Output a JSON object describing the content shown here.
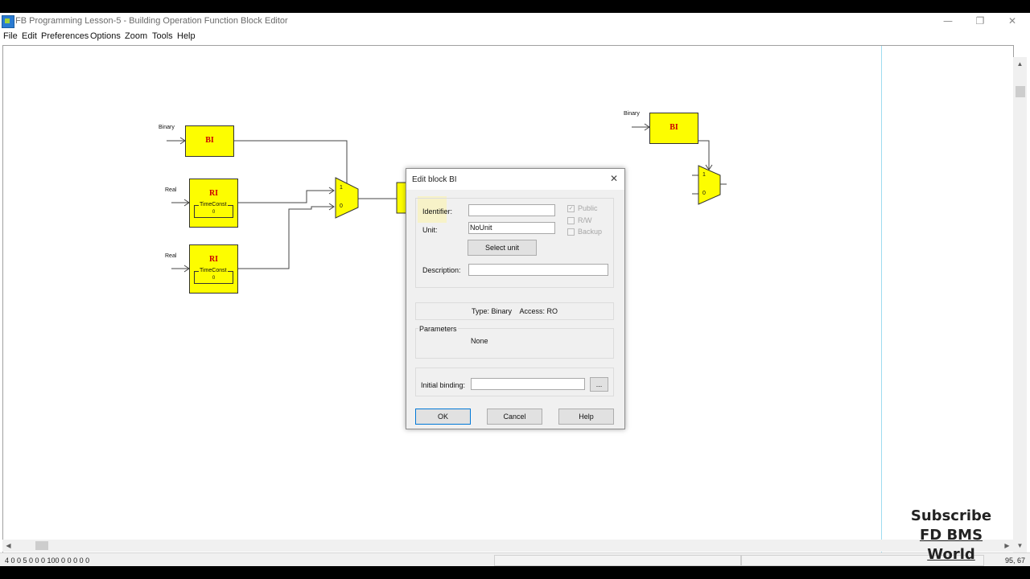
{
  "window": {
    "title": "FB Programming Lesson-5 - Building Operation Function Block Editor",
    "minimize_glyph": "—",
    "maximize_glyph": "❐",
    "close_glyph": "✕"
  },
  "menu": [
    "File",
    "Edit",
    "Preferences",
    "Options",
    "Zoom",
    "Tools",
    "Help"
  ],
  "canvas": {
    "inputs": {
      "binary_1": "Binary",
      "real_1": "Real",
      "real_2": "Real",
      "binary_2": "Binary"
    },
    "blocks": {
      "bi_1": "BI",
      "ri_1": "RI",
      "ri_2": "RI",
      "bi_2": "BI"
    },
    "params": {
      "ri_1": {
        "label": "TimeConst",
        "value": "0"
      },
      "ri_2": {
        "label": "TimeConst",
        "value": "0"
      }
    },
    "mux": {
      "in1": "1",
      "in0": "0"
    },
    "mux_2": {
      "in1": "1",
      "in0": "0"
    }
  },
  "dialog": {
    "title": "Edit block BI",
    "close_glyph": "✕",
    "identifier_label": "Identifier:",
    "identifier_value": "",
    "unit_label": "Unit:",
    "unit_value": "NoUnit",
    "select_unit": "Select unit",
    "description_label": "Description:",
    "description_value": "",
    "public_label": "Public",
    "rw_label": "R/W",
    "backup_label": "Backup",
    "type_access": "Type: Binary    Access: RO",
    "parameters_label": "Parameters",
    "parameters_value": "None",
    "initial_binding_label": "Initial binding:",
    "initial_binding_value": "",
    "browse": "...",
    "ok": "OK",
    "cancel": "Cancel",
    "help": "Help"
  },
  "status": {
    "left": "4 0 0 5 0   0 0 100 0 0 0 0 0",
    "right": "95, 67"
  },
  "watermark": {
    "line1": "Subscribe",
    "line2": "FD BMS World"
  },
  "scroll": {
    "up": "▲",
    "down": "▼",
    "left": "◀",
    "right": "▶"
  },
  "colors": {
    "block_fill": "#fdfd00",
    "block_title": "#cc0000",
    "guide_line": "#9fdcf0"
  }
}
